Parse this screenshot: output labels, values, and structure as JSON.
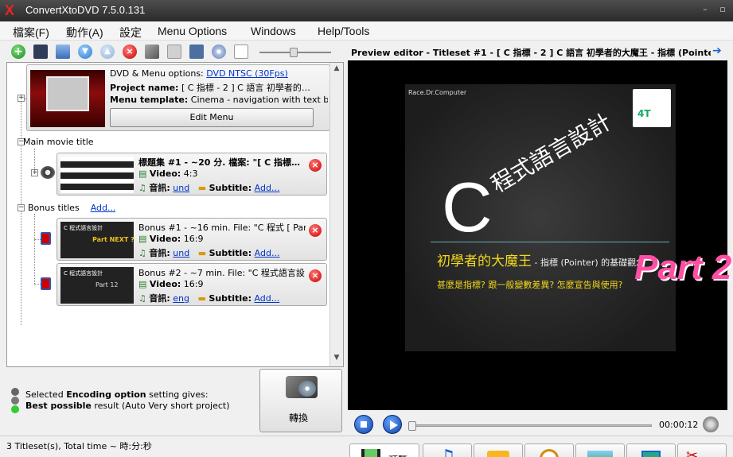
{
  "window": {
    "title": "ConvertXtoDVD 7.5.0.131",
    "logo_glyph": "X"
  },
  "menu": [
    "檔案(F)",
    "動作(A)",
    "設定",
    "Menu Options",
    "Windows",
    "Help/Tools"
  ],
  "toolbar": {
    "icons": [
      "add-icon",
      "save-icon",
      "merge-icon",
      "move-down-icon",
      "move-up-icon",
      "remove-icon",
      "settings-icon",
      "layout-icon",
      "monitor-icon",
      "disc-icon",
      "document-icon"
    ]
  },
  "dvd_card": {
    "options_label": "DVD & Menu options:",
    "options_value": "DVD NTSC (30Fps)",
    "project_label": "Project name:",
    "project_value": "[ C 指標 - 2 ] C 語言 初學者的…",
    "template_label": "Menu template:",
    "template_value": "Cinema - navigation with text b…",
    "edit_menu": "Edit Menu"
  },
  "main_movie": {
    "header": "Main movie title",
    "title": "標題集 #1 - ~20 分. 檔案: \"[ C 指標…",
    "video_label": "Video:",
    "video_value": "4:3",
    "audio_label": "音訊:",
    "audio_value": "und",
    "subtitle_label": "Subtitle:",
    "subtitle_value": "Add..."
  },
  "bonus": {
    "header": "Bonus titles",
    "add": "Add...",
    "items": [
      {
        "title": "Bonus #1 - ~16 min. File: \"C 程式 [ Part…",
        "video_label": "Video:",
        "video_value": "16:9",
        "audio_label": "音訊:",
        "audio_value": "und",
        "subtitle_label": "Subtitle:",
        "subtitle_value": "Add...",
        "thumb_text": "Part NEXT ?",
        "thumb_title": "C 程式語言設計"
      },
      {
        "title": "Bonus #2 - ~7 min. File: \"C 程式語言設…",
        "video_label": "Video:",
        "video_value": "16:9",
        "audio_label": "音訊:",
        "audio_value": "eng",
        "subtitle_label": "Subtitle:",
        "subtitle_value": "Add...",
        "thumb_text": "Part 12",
        "thumb_title": "C 程式語言設計"
      }
    ]
  },
  "encoding": {
    "line1_pre": "Selected ",
    "line1_bold": "Encoding option",
    "line1_post": " setting gives:",
    "line2_bold": "Best possible",
    "line2_post": " result (Auto Very short project)"
  },
  "convert_button": "轉換",
  "status": "3 Titleset(s), Total time ~ 時:分:秒",
  "preview": {
    "header": "Preview editor - Titleset #1 - [ C 指標 - 2 ] C 語言 初學者的大魔王 - 指標 (Pointe",
    "frame": {
      "channel": "Race.Dr.Computer",
      "big_c": "C",
      "course": "程式語言設計",
      "part": "Part 2",
      "subtitle_main": "初學者的大魔王",
      "subtitle_rest": " - 指標 (Pointer) 的基礎觀念",
      "question": "甚麼是指標? 跟一般變數差異? 怎麼宣告與使用?",
      "logo_text": "4T"
    },
    "time": "00:00:12",
    "progress": 0.0,
    "tab_preview": "預覽"
  },
  "colors": {
    "accent": "#0033cc",
    "part_pink": "#ff4fa3",
    "subtitle_yellow": "#f2d91a"
  }
}
